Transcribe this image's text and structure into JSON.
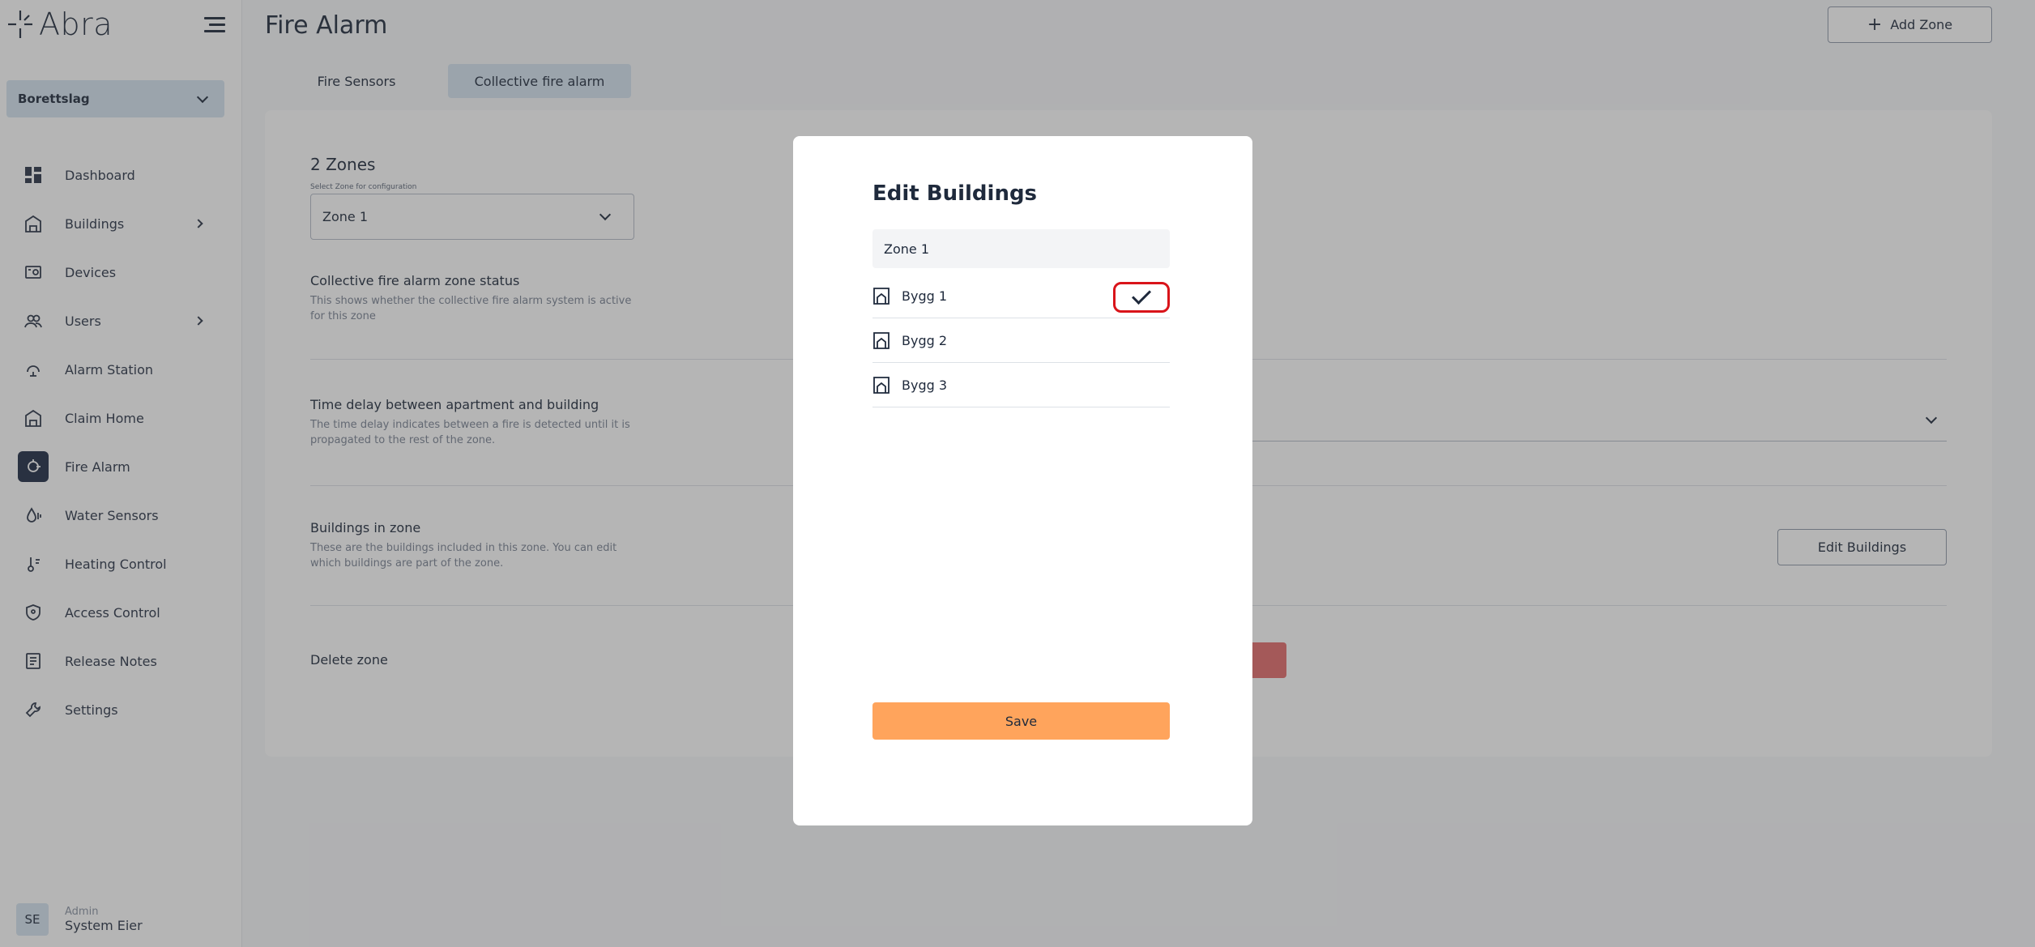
{
  "app": {
    "logo_text": "Abra"
  },
  "sidebar": {
    "org_select": "Borettslag",
    "items": [
      {
        "label": "Dashboard",
        "icon": "dashboard-icon",
        "has_arrow": false
      },
      {
        "label": "Buildings",
        "icon": "building-icon",
        "has_arrow": true
      },
      {
        "label": "Devices",
        "icon": "devices-icon",
        "has_arrow": false
      },
      {
        "label": "Users",
        "icon": "users-icon",
        "has_arrow": true
      },
      {
        "label": "Alarm Station",
        "icon": "alarm-station-icon",
        "has_arrow": false
      },
      {
        "label": "Claim Home",
        "icon": "claim-home-icon",
        "has_arrow": false
      },
      {
        "label": "Fire Alarm",
        "icon": "fire-alarm-icon",
        "has_arrow": false,
        "active": true
      },
      {
        "label": "Water Sensors",
        "icon": "water-sensor-icon",
        "has_arrow": false
      },
      {
        "label": "Heating Control",
        "icon": "heating-icon",
        "has_arrow": false
      },
      {
        "label": "Access Control",
        "icon": "shield-icon",
        "has_arrow": false
      },
      {
        "label": "Release Notes",
        "icon": "notes-icon",
        "has_arrow": false
      },
      {
        "label": "Settings",
        "icon": "wrench-icon",
        "has_arrow": false
      }
    ],
    "user": {
      "initials": "SE",
      "role": "Admin",
      "name": "System Eier"
    }
  },
  "header": {
    "title": "Fire Alarm",
    "add_zone_label": "Add Zone"
  },
  "tabs": [
    {
      "label": "Fire Sensors"
    },
    {
      "label": "Collective fire alarm",
      "active": true
    }
  ],
  "zones": {
    "count_label": "2 Zones",
    "select_caption": "Select Zone for configuration",
    "selected_zone": "Zone 1"
  },
  "sections": {
    "status": {
      "title": "Collective fire alarm zone status",
      "desc": "This shows whether the collective fire alarm system is active for this zone"
    },
    "delay": {
      "title": "Time delay between apartment and building",
      "desc": "The time delay indicates between a fire is detected until it is propagated to the rest of the zone."
    },
    "buildings": {
      "title": "Buildings in zone",
      "desc": "These are the buildings included in this zone. You can edit which buildings are part of the zone.",
      "edit_label": "Edit Buildings"
    },
    "delete": {
      "title": "Delete zone"
    }
  },
  "modal": {
    "title": "Edit Buildings",
    "zone_name": "Zone 1",
    "buildings": [
      {
        "label": "Bygg 1",
        "checked": true
      },
      {
        "label": "Bygg 2",
        "checked": false
      },
      {
        "label": "Bygg 3",
        "checked": false
      }
    ],
    "save_label": "Save"
  },
  "colors": {
    "accent": "#ffa45c",
    "nav_active": "#1d2a44",
    "select_bg": "#d6e4f0",
    "danger": "#e46b6b",
    "highlight": "#d9141a"
  }
}
